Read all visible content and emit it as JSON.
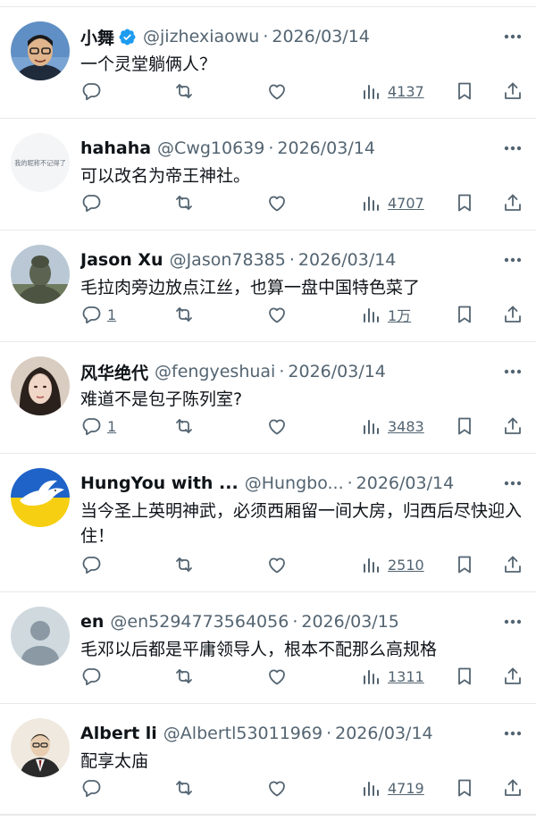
{
  "colors": {
    "text": "#0f1419",
    "secondary": "#536471",
    "divider": "#e7e9ea",
    "verified": "#1d9bf0"
  },
  "replies": [
    {
      "name": "小舞",
      "verified": true,
      "handle": "@jizhexiaowu",
      "date": "2026/03/14",
      "text": "一个灵堂躺俩人？",
      "replies_count": "",
      "views": "4137",
      "avatar_icon": "man-glasses-photo-avatar"
    },
    {
      "name": "hahaha",
      "verified": false,
      "handle": "@Cwg10639",
      "date": "2026/03/14",
      "text": "可以改名为帝王神社。",
      "replies_count": "",
      "views": "4707",
      "avatar_icon": "text-avatar",
      "avatar_text": "我的昵称不记得了"
    },
    {
      "name": "Jason Xu",
      "verified": false,
      "handle": "@Jason78385",
      "date": "2026/03/14",
      "text": "毛拉肉旁边放点江丝，也算一盘中国特色菜了",
      "replies_count": "1",
      "views": "1万",
      "avatar_icon": "buddha-statue-avatar"
    },
    {
      "name": "风华绝代",
      "verified": false,
      "handle": "@fengyeshuai",
      "date": "2026/03/14",
      "text": "难道不是包子陈列室?",
      "replies_count": "1",
      "views": "3483",
      "avatar_icon": "woman-photo-avatar"
    },
    {
      "name": "HungYou with ...",
      "verified": false,
      "handle": "@Hungbo...",
      "date": "2026/03/14",
      "text": "当今圣上英明神武，必须西厢留一间大房，归西后尽快迎入住！",
      "replies_count": "",
      "views": "2510",
      "avatar_icon": "dove-ukraine-flag-avatar"
    },
    {
      "name": "en",
      "verified": false,
      "handle": "@en5294773564056",
      "date": "2026/03/15",
      "text": "毛邓以后都是平庸领导人，根本不配那么高规格",
      "replies_count": "",
      "views": "1311",
      "avatar_icon": "default-profile-avatar"
    },
    {
      "name": "Albert li",
      "verified": false,
      "handle": "@Albertl53011969",
      "date": "2026/03/14",
      "text": "配享太庙",
      "replies_count": "",
      "views": "4719",
      "avatar_icon": "suited-man-sketch-avatar"
    }
  ],
  "separator": "·"
}
